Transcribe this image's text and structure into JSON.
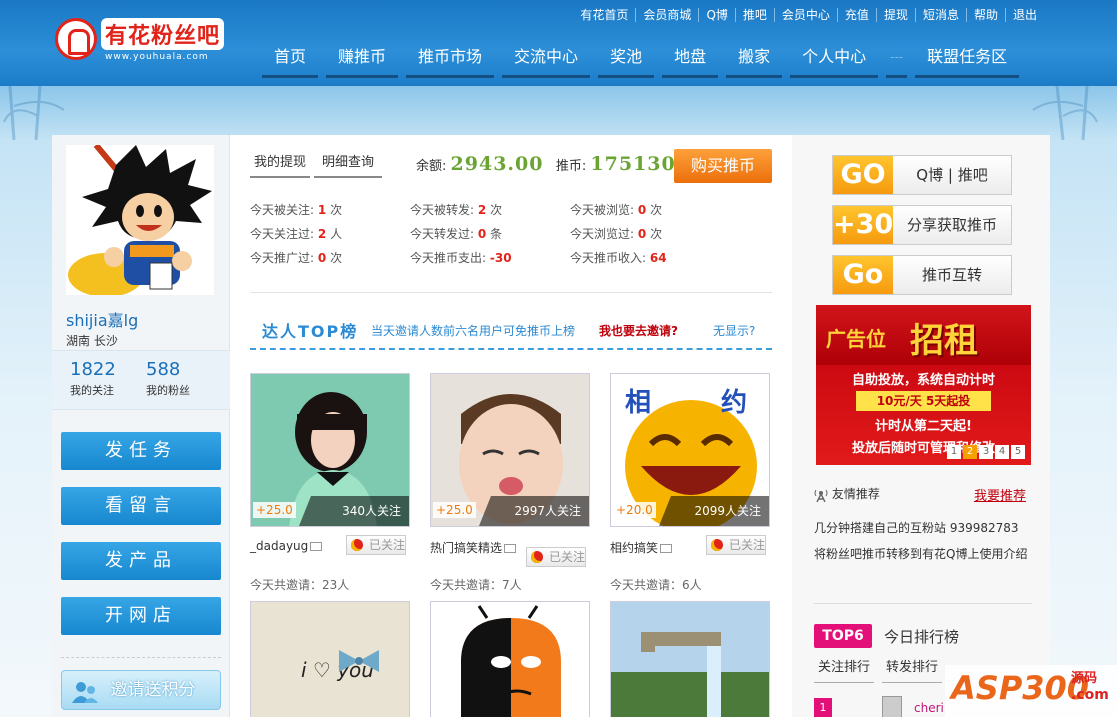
{
  "logo": {
    "name": "有花粉丝吧",
    "url": "www.youhuala.com"
  },
  "toplinks": [
    "有花首页",
    "会员商城",
    "Q博",
    "推吧",
    "会员中心",
    "充值",
    "提现",
    "短消息",
    "帮助",
    "退出"
  ],
  "nav": [
    "首页",
    "赚推币",
    "推币市场",
    "交流中心",
    "奖池",
    "地盘",
    "搬家",
    "个人中心",
    "---",
    "联盟任务区"
  ],
  "user": {
    "name": "shijia嘉lg",
    "location": "湖南  长沙",
    "follow_count": "1822",
    "follow_label": "我的关注",
    "fan_count": "588",
    "fan_label": "我的粉丝"
  },
  "left_buttons": [
    "发任务",
    "看留言",
    "发产品",
    "开网店"
  ],
  "invite_label": "邀请送积分",
  "tabs": [
    "我的提现",
    "明细查询"
  ],
  "balance": {
    "label": "余额:",
    "value": "2943.00",
    "coin_label": "推币:",
    "coin_value": "175130",
    "buy": "购买推币"
  },
  "stats": [
    {
      "label": "今天被关注:",
      "value": "1",
      "unit": "次"
    },
    {
      "label": "今天被转发:",
      "value": "2",
      "unit": "次"
    },
    {
      "label": "今天被浏览:",
      "value": "0",
      "unit": "次"
    },
    {
      "label": "今天关注过:",
      "value": "2",
      "unit": "人"
    },
    {
      "label": "今天转发过:",
      "value": "0",
      "unit": "条"
    },
    {
      "label": "今天浏览过:",
      "value": "0",
      "unit": "次"
    },
    {
      "label": "今天推广过:",
      "value": "0",
      "unit": "次"
    },
    {
      "label": "今天推币支出:",
      "value": "-30",
      "unit": ""
    },
    {
      "label": "今天推币收入:",
      "value": "64",
      "unit": ""
    }
  ],
  "top": {
    "title": "达人TOP榜",
    "subtitle": "当天邀请人数前六名用户可免推币上榜",
    "invite": "我也要去邀请?",
    "none": "无显示?"
  },
  "cards": [
    {
      "points": "+25.0",
      "fans": "340人关注",
      "name": "_dadayug",
      "followed": "已关注",
      "invites": "今天共邀请：23人"
    },
    {
      "points": "+25.0",
      "fans": "2997人关注",
      "name": "热门搞笑精选",
      "followed": "已关注",
      "invites": "今天共邀请：7人"
    },
    {
      "points": "+20.0",
      "fans": "2099人关注",
      "name": "相约搞笑",
      "followed": "已关注",
      "invites": "今天共邀请：6人"
    }
  ],
  "card3_text": {
    "a": "相",
    "b": "约"
  },
  "card4_text": "i ♡ you",
  "go_buttons": [
    {
      "left": "GO",
      "text": "Q博 | 推吧"
    },
    {
      "left": "+30",
      "text": "分享获取推币"
    },
    {
      "left": "Go",
      "text": "推币互转"
    }
  ],
  "ad": {
    "t1": "广告位",
    "t2": "招租",
    "l1": "自助投放，系统自动计时",
    "price": "10元/天  5天起投",
    "l2": "计时从第二天起!",
    "l3": "投放后随时可管理和修改",
    "pages": [
      "1",
      "2",
      "3",
      "4",
      "5"
    ]
  },
  "friend": {
    "title": "友情推荐",
    "recommend": "我要推荐",
    "t1": "几分钟搭建自己的互粉站  939982783",
    "t2": "将粉丝吧推币转移到有花Q博上使用介绍"
  },
  "ranking": {
    "badge": "TOP6",
    "title": "今日排行榜",
    "tabs": [
      "关注排行",
      "转发排行"
    ],
    "first_rank": "1",
    "first_name": "cheri"
  },
  "watermark": {
    "brand": "ASP300",
    "s": "源码",
    ".com": ".com"
  }
}
